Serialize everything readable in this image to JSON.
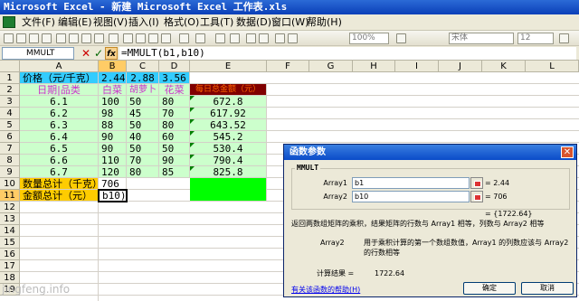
{
  "window": {
    "title": "Microsoft Excel - 新建 Microsoft Excel 工作表.xls"
  },
  "menu": {
    "items": [
      "文件(F)",
      "编辑(E)",
      "视图(V)",
      "插入(I)",
      "格式(O)",
      "工具(T)",
      "数据(D)",
      "窗口(W)",
      "帮助(H)"
    ]
  },
  "toolbar": {
    "zoom": "100%",
    "font": "宋体",
    "font_size": "12"
  },
  "formula_bar": {
    "name_box": "MMULT",
    "cancel": "✕",
    "enter": "✓",
    "fx": "fx",
    "formula": "=MMULT(b1,b10)"
  },
  "grid": {
    "columns": [
      "A",
      "B",
      "C",
      "D",
      "E",
      "F",
      "G",
      "H",
      "I",
      "J",
      "K",
      "L"
    ],
    "rows": [
      "1",
      "2",
      "3",
      "4",
      "5",
      "6",
      "7",
      "8",
      "9",
      "10",
      "11",
      "12",
      "13",
      "14",
      "15",
      "16",
      "17",
      "18",
      "19"
    ],
    "cells": {
      "A1": "价格（元/千克）",
      "B1": "2.44",
      "C1": "2.88",
      "D1": "3.56",
      "A2": "日期|品类",
      "B2": "白菜",
      "C2": "胡萝卜",
      "D2": "花菜",
      "E2": "每日总金额（元）",
      "A3": "6.1",
      "B3": "100",
      "C3": "50",
      "D3": "80",
      "E3": "672.8",
      "A4": "6.2",
      "B4": "98",
      "C4": "45",
      "D4": "70",
      "E4": "617.92",
      "A5": "6.3",
      "B5": "88",
      "C5": "50",
      "D5": "80",
      "E5": "643.52",
      "A6": "6.4",
      "B6": "90",
      "C6": "40",
      "D6": "60",
      "E6": "545.2",
      "A7": "6.5",
      "B7": "90",
      "C7": "50",
      "D7": "50",
      "E7": "530.4",
      "A8": "6.6",
      "B8": "110",
      "C8": "70",
      "D8": "90",
      "E8": "790.4",
      "A9": "6.7",
      "B9": "120",
      "C9": "80",
      "D9": "85",
      "E9": "825.8",
      "A10": "数量总计（千克）",
      "B10": "706",
      "A11": "金额总计（元）",
      "B11": "b10)"
    }
  },
  "dialog": {
    "title": "函数参数",
    "close": "✕",
    "group": "MMULT",
    "arg1_label": "Array1",
    "arg1_value": "b1",
    "arg1_result": "= 2.44",
    "arg2_label": "Array2",
    "arg2_value": "b10",
    "arg2_result": "= 706",
    "overall_result": "= {1722.64}",
    "description": "返回两数组矩阵的乘积，结果矩阵的行数与 Array1 相等，列数与 Array2 相等",
    "arg2_name": "Array2",
    "arg2_help": "用于乘积计算的第一个数组数值，Array1 的列数应该与 Array2 的行数相等",
    "result_label": "计算结果 =",
    "result_value": "1722.64",
    "help_link": "有关该函数的帮助(H)",
    "ok": "确定",
    "cancel": "取消"
  },
  "watermark": "jingfeng.info",
  "colors": {
    "blue_fill": "#33ccff",
    "green_fill": "#ccffcc",
    "yellow_fill": "#ffcc00",
    "darkred_fill": "#800000",
    "lime_fill": "#00ff00",
    "title_blue": "#0a3fb8"
  }
}
